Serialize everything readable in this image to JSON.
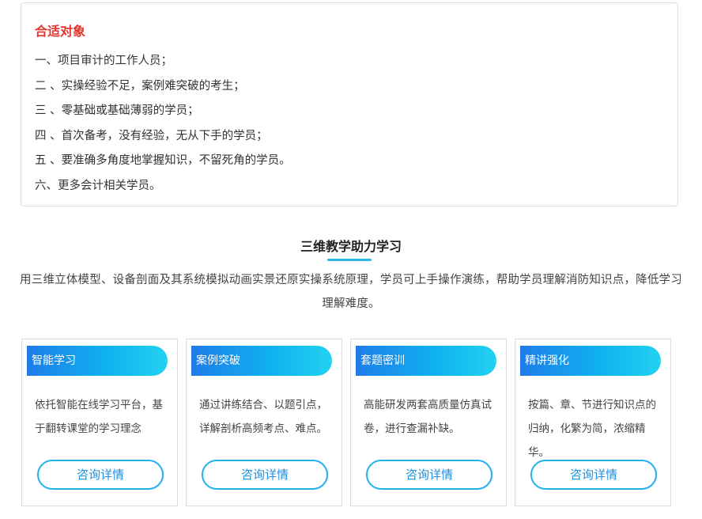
{
  "suitable": {
    "title": "合适对象",
    "items": [
      "一、项目审计的工作人员；",
      "二 、实操经验不足，案例难突破的考生；",
      "三 、零基础或基础薄弱的学员；",
      "四 、首次备考，没有经验，无从下手的学员；",
      "五 、要准确多角度地掌握知识，不留死角的学员。",
      "六、更多会计相关学员。"
    ]
  },
  "section": {
    "title": "三维教学助力学习",
    "description": "用三维立体模型、设备剖面及其系统模拟动画实景还原实操系统原理，学员可上手操作演练，帮助学员理解消防知识点，降低学习理解难度。"
  },
  "cards": [
    {
      "tab_label": "智能学习",
      "description": "依托智能在线学习平台，基于翻转课堂的学习理念",
      "button_label": "咨询详情"
    },
    {
      "tab_label": "案例突破",
      "description": "通过讲练结合、以题引点，详解剖析高频考点、难点。",
      "button_label": "咨询详情"
    },
    {
      "tab_label": "套题密训",
      "description": "高能研发两套高质量仿真试卷，进行查漏补缺。",
      "button_label": "咨询详情"
    },
    {
      "tab_label": "精讲强化",
      "description": "按篇、章、节进行知识点的归纳，化繁为简，浓缩精华。",
      "button_label": "咨询详情"
    }
  ],
  "colors": {
    "accent_red": "#e5322d",
    "accent_blue": "#1fb2e8",
    "gradient_start": "#1e7de8",
    "gradient_end": "#20d2ef"
  }
}
